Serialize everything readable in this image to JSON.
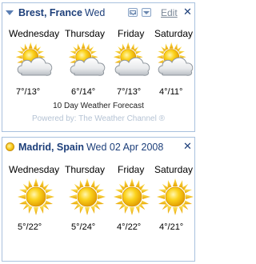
{
  "widgets": [
    {
      "location": "Brest, France",
      "date": "Wed",
      "edit_label": "Edit",
      "close_label": "✕",
      "days": [
        {
          "name": "Wednesday",
          "temp": "7°/13°",
          "icon": "sun-behind-cloud-icon"
        },
        {
          "name": "Thursday",
          "temp": "6°/14°",
          "icon": "sun-behind-cloud-icon"
        },
        {
          "name": "Friday",
          "temp": "7°/13°",
          "icon": "sun-behind-cloud-icon"
        },
        {
          "name": "Saturday",
          "temp": "4°/11°",
          "icon": "sun-behind-cloud-icon"
        }
      ],
      "forecast_link": "10 Day Weather Forecast",
      "powered_by": "Powered by: The Weather Channel ®"
    },
    {
      "location": "Madrid, Spain",
      "date": "Wed 02 Apr 2008",
      "close_label": "✕",
      "days": [
        {
          "name": "Wednesday",
          "temp": "5°/22°",
          "icon": "sunny-icon"
        },
        {
          "name": "Thursday",
          "temp": "5°/24°",
          "icon": "sunny-icon"
        },
        {
          "name": "Friday",
          "temp": "4°/22°",
          "icon": "sunny-icon"
        },
        {
          "name": "Saturday",
          "temp": "4°/21°",
          "icon": "sunny-icon"
        }
      ]
    }
  ],
  "colors": {
    "border": "#a9c1de",
    "title": "#1d3f7a",
    "powered": "#b5c3d4",
    "sun": "#f7c512",
    "cloud": "#d8dce0"
  }
}
